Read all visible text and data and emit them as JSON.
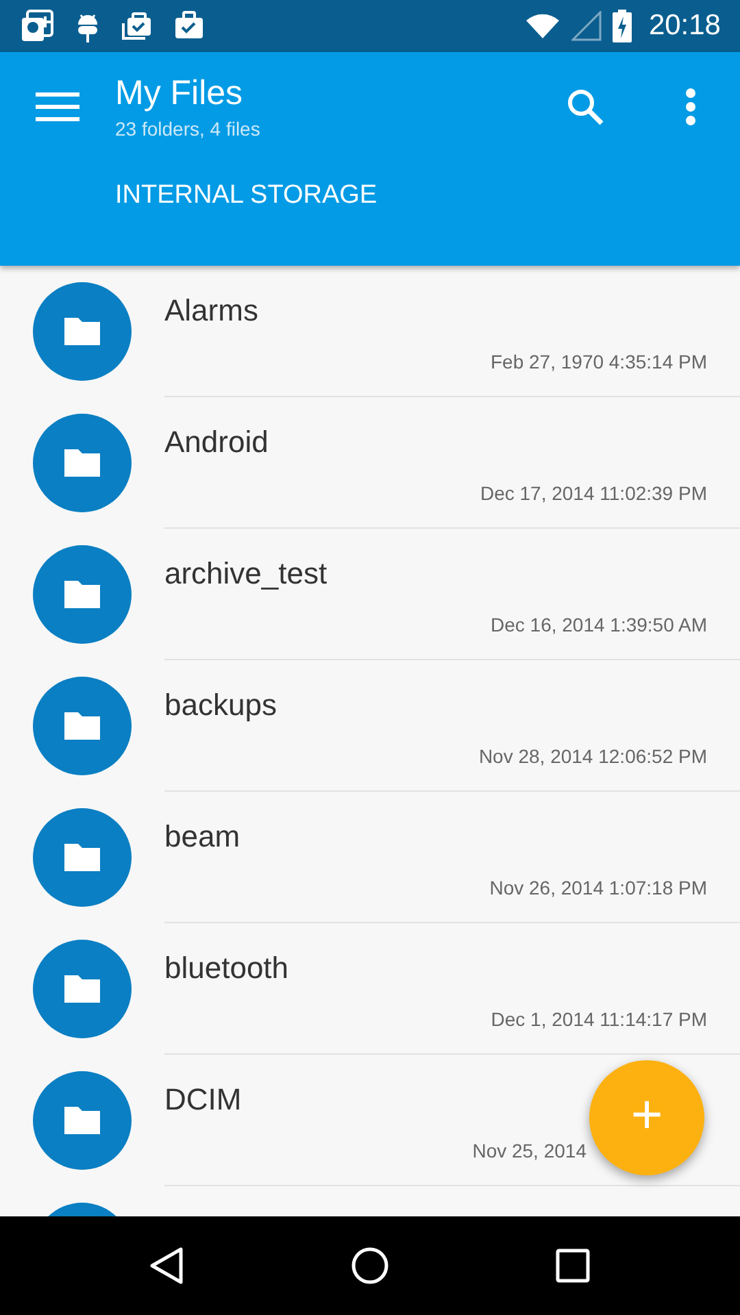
{
  "status_bar": {
    "time": "20:18"
  },
  "app_bar": {
    "title": "My Files",
    "subtitle": "23 folders, 4 files",
    "tab": "INTERNAL STORAGE"
  },
  "files": [
    {
      "kind": "folder",
      "name": "Alarms",
      "date": "Feb 27, 1970 4:35:14 PM"
    },
    {
      "kind": "folder",
      "name": "Android",
      "date": "Dec 17, 2014 11:02:39 PM"
    },
    {
      "kind": "folder",
      "name": "archive_test",
      "date": "Dec 16, 2014 1:39:50 AM"
    },
    {
      "kind": "folder",
      "name": "backups",
      "date": "Nov 28, 2014 12:06:52 PM"
    },
    {
      "kind": "folder",
      "name": "beam",
      "date": "Nov 26, 2014 1:07:18 PM"
    },
    {
      "kind": "folder",
      "name": "bluetooth",
      "date": "Dec 1, 2014 11:14:17 PM"
    },
    {
      "kind": "folder",
      "name": "DCIM",
      "date": "Nov 25, 2014",
      "under_fab": true
    },
    {
      "kind": "folder"
    }
  ],
  "fab": {
    "label": "+"
  }
}
